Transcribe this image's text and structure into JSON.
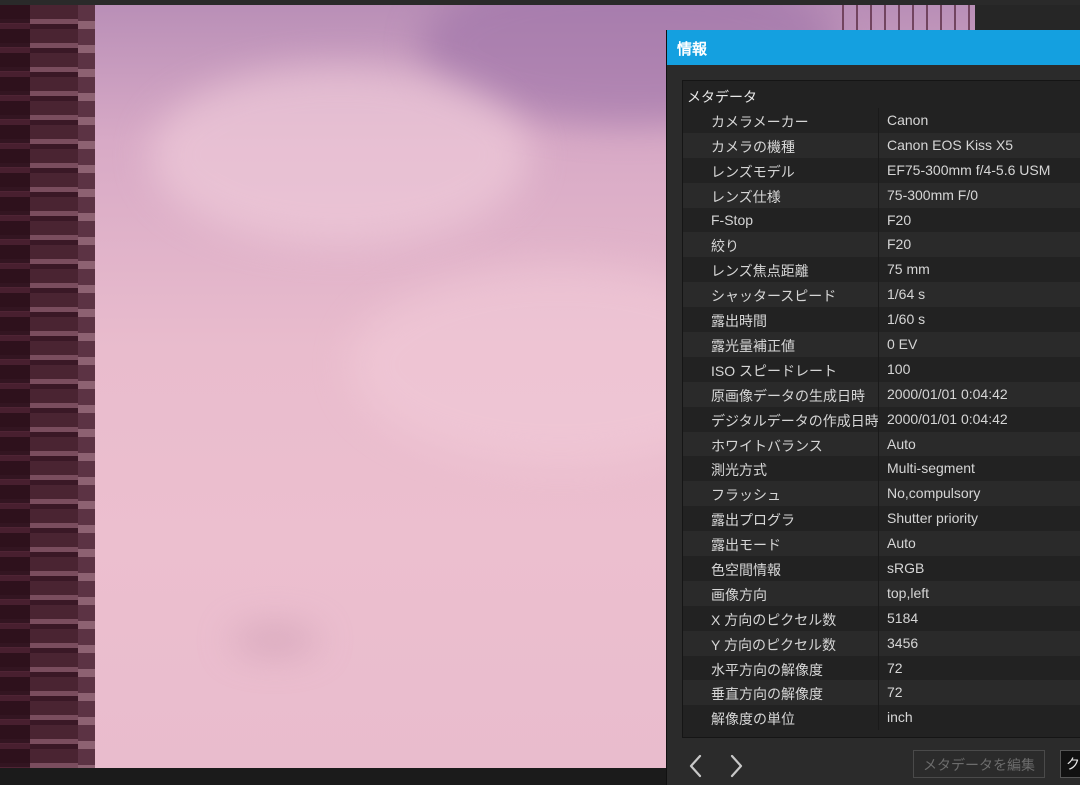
{
  "panel": {
    "title": "情報",
    "section_header": "メタデータ",
    "rows": [
      {
        "key": "カメラメーカー",
        "value": "Canon"
      },
      {
        "key": "カメラの機種",
        "value": "Canon EOS Kiss X5"
      },
      {
        "key": "レンズモデル",
        "value": "EF75-300mm f/4-5.6 USM"
      },
      {
        "key": "レンズ仕様",
        "value": "75-300mm F/0"
      },
      {
        "key": "F-Stop",
        "value": "F20"
      },
      {
        "key": "絞り",
        "value": "F20"
      },
      {
        "key": "レンズ焦点距離",
        "value": "75 mm"
      },
      {
        "key": "シャッタースピード",
        "value": "1/64 s"
      },
      {
        "key": "露出時間",
        "value": "1/60 s"
      },
      {
        "key": "露光量補正値",
        "value": "0 EV"
      },
      {
        "key": "ISO スピードレート",
        "value": "100"
      },
      {
        "key": "原画像データの生成日時",
        "value": "2000/01/01 0:04:42"
      },
      {
        "key": "デジタルデータの作成日時",
        "value": "2000/01/01 0:04:42"
      },
      {
        "key": "ホワイトバランス",
        "value": "Auto"
      },
      {
        "key": "測光方式",
        "value": "Multi-segment"
      },
      {
        "key": "フラッシュ",
        "value": "No,compulsory"
      },
      {
        "key": "露出プログラ",
        "value": "Shutter priority"
      },
      {
        "key": "露出モード",
        "value": "Auto"
      },
      {
        "key": "色空間情報",
        "value": "sRGB"
      },
      {
        "key": "画像方向",
        "value": "top,left"
      },
      {
        "key": "X 方向のピクセル数",
        "value": "5184"
      },
      {
        "key": "Y 方向のピクセル数",
        "value": "3456"
      },
      {
        "key": "水平方向の解像度",
        "value": "72"
      },
      {
        "key": "垂直方向の解像度",
        "value": "72"
      },
      {
        "key": "解像度の単位",
        "value": "inch"
      }
    ],
    "footer": {
      "prev_icon": "chevron-left-icon",
      "next_icon": "chevron-right-icon",
      "edit_label": "メタデータを編集",
      "close_label": "ク"
    }
  },
  "colors": {
    "titlebar": "#14a0e0",
    "panel_bg": "#2b2b2b",
    "text": "#d6d6d6"
  }
}
